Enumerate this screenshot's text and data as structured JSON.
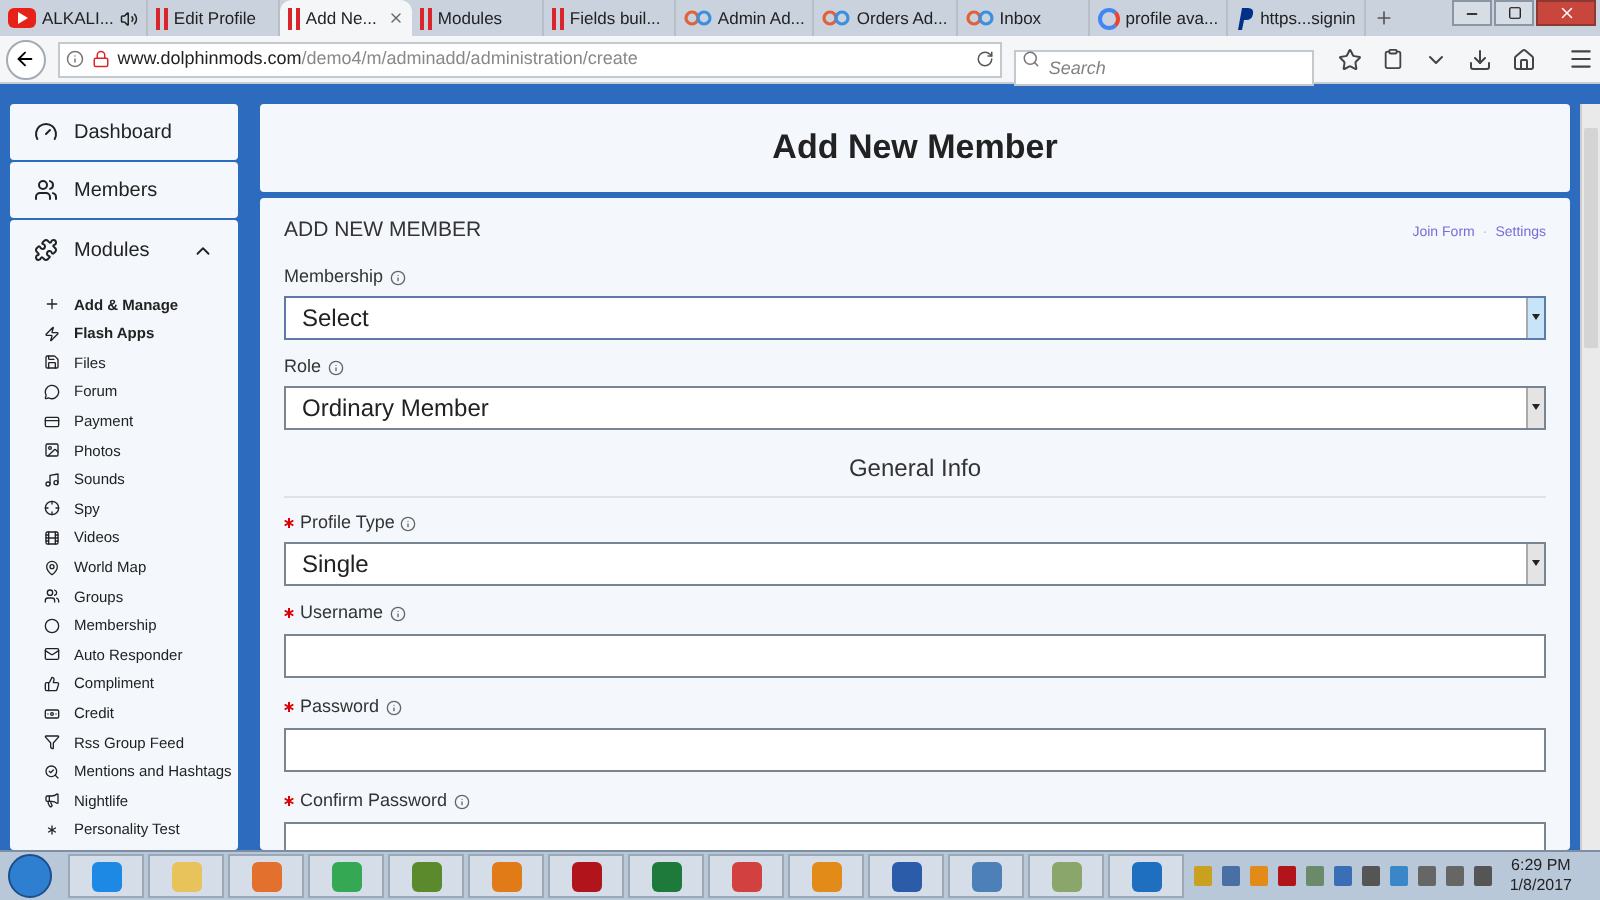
{
  "browser": {
    "tabs": [
      {
        "kind": "video",
        "label": "ALKALI...",
        "selected": false,
        "audio": true
      },
      {
        "kind": "bars",
        "label": "Edit Profile",
        "selected": false,
        "audio": false
      },
      {
        "kind": "bars",
        "label": "Add Ne...",
        "selected": true,
        "audio": false
      },
      {
        "kind": "bars",
        "label": "Modules",
        "selected": false,
        "audio": false
      },
      {
        "kind": "bars",
        "label": "Fields buil...",
        "selected": false,
        "audio": false
      },
      {
        "kind": "rings",
        "label": "Admin Ad...",
        "selected": false,
        "audio": false
      },
      {
        "kind": "rings",
        "label": "Orders Ad...",
        "selected": false,
        "audio": false
      },
      {
        "kind": "rings",
        "label": "Inbox",
        "selected": false,
        "audio": false
      },
      {
        "kind": "google",
        "label": "profile ava...",
        "selected": false,
        "audio": false
      },
      {
        "kind": "pay",
        "label": "https...signin",
        "selected": false,
        "audio": false
      }
    ],
    "url_domain": "www.dolphinmods.com",
    "url_path": "/demo4/m/adminadd/administration/create",
    "search": {
      "placeholder": "Search"
    }
  },
  "sidebar": {
    "items": [
      {
        "label": "Dashboard"
      },
      {
        "label": "Members"
      }
    ],
    "modules": {
      "label": "Modules",
      "expanded": true,
      "items": [
        {
          "label": "Add & Manage",
          "bold": true
        },
        {
          "label": "Flash Apps",
          "bold": true
        },
        {
          "label": "Files",
          "bold": false
        },
        {
          "label": "Forum",
          "bold": false
        },
        {
          "label": "Payment",
          "bold": false
        },
        {
          "label": "Photos",
          "bold": false
        },
        {
          "label": "Sounds",
          "bold": false
        },
        {
          "label": "Spy",
          "bold": false
        },
        {
          "label": "Videos",
          "bold": false
        },
        {
          "label": "World Map",
          "bold": false
        },
        {
          "label": "Groups",
          "bold": false
        },
        {
          "label": "Membership",
          "bold": false
        },
        {
          "label": "Auto Responder",
          "bold": false
        },
        {
          "label": "Compliment",
          "bold": false
        },
        {
          "label": "Credit",
          "bold": false
        },
        {
          "label": "Rss Group Feed",
          "bold": false
        },
        {
          "label": "Mentions and Hashtags",
          "bold": false
        },
        {
          "label": "Nightlife",
          "bold": false
        },
        {
          "label": "Personality Test",
          "bold": false
        }
      ]
    }
  },
  "page_title": "Add New Member",
  "form": {
    "heading": "ADD NEW MEMBER",
    "links": [
      "Join Form",
      "Settings"
    ],
    "link_separator": "·",
    "fields": [
      {
        "kind": "select",
        "label": "Membership",
        "required": false,
        "value": "Select",
        "focused": true
      },
      {
        "kind": "select",
        "label": "Role",
        "required": false,
        "value": "Ordinary Member",
        "focused": false
      },
      {
        "kind": "heading",
        "label": "General Info"
      },
      {
        "kind": "select",
        "label": "Profile Type",
        "required": true,
        "value": "Single",
        "focused": false
      },
      {
        "kind": "text",
        "label": "Username",
        "required": true,
        "focused": false
      },
      {
        "kind": "text",
        "label": "Password",
        "required": true,
        "focused": false
      },
      {
        "kind": "text",
        "label": "Confirm Password",
        "required": true,
        "focused": false
      }
    ]
  },
  "taskbar": {
    "time": "6:29 PM",
    "date": "1/8/2017"
  }
}
